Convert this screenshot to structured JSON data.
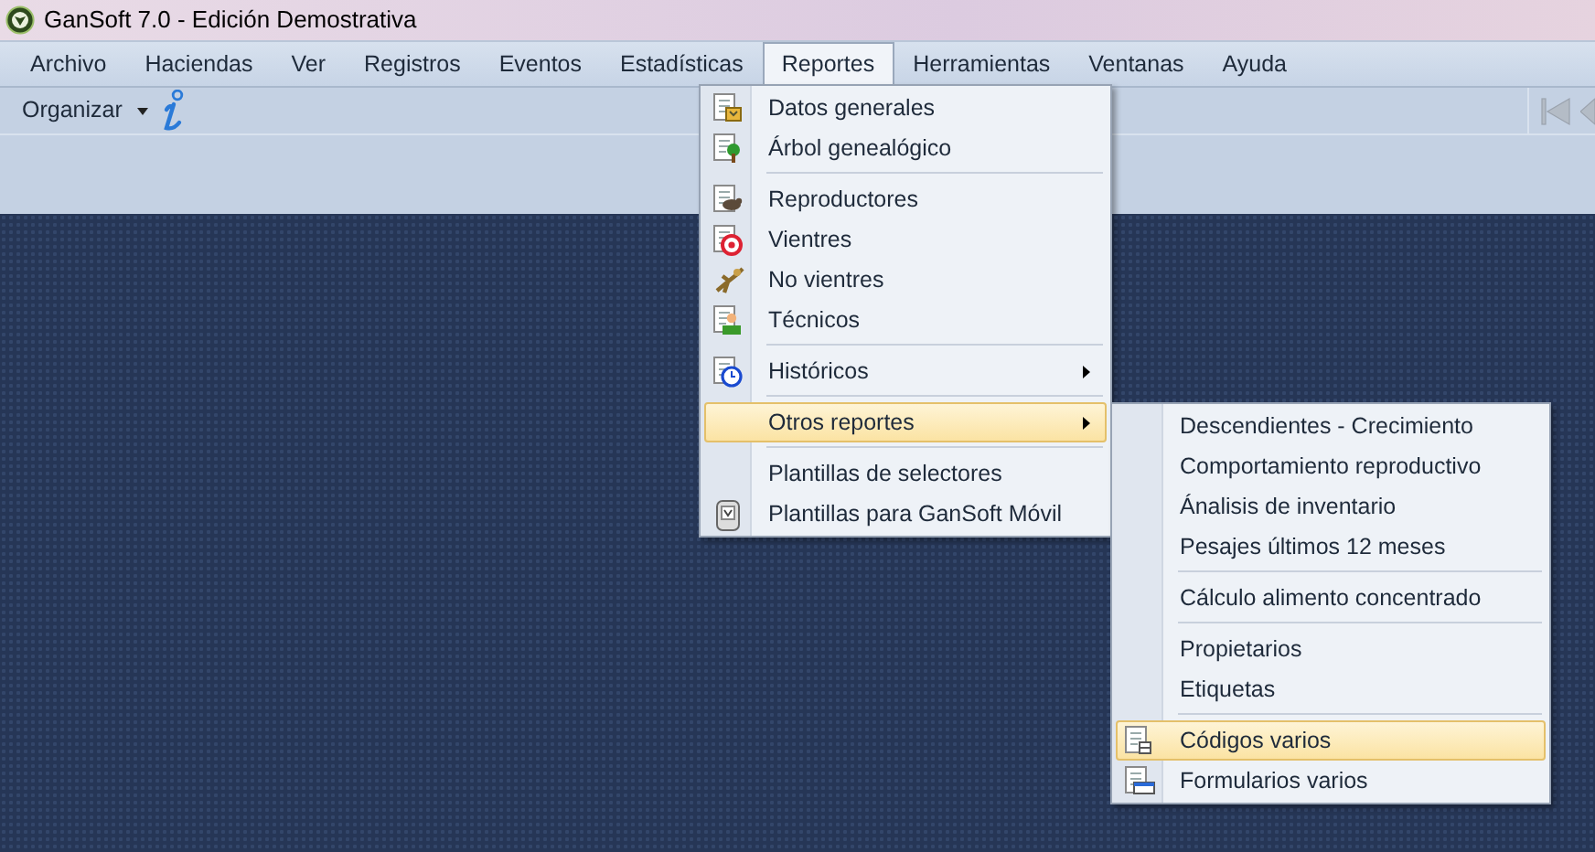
{
  "window": {
    "title": "GanSoft 7.0 - Edición Demostrativa"
  },
  "menubar": [
    {
      "label": "Archivo",
      "selected": false
    },
    {
      "label": "Haciendas",
      "selected": false
    },
    {
      "label": "Ver",
      "selected": false
    },
    {
      "label": "Registros",
      "selected": false
    },
    {
      "label": "Eventos",
      "selected": false
    },
    {
      "label": "Estadísticas",
      "selected": false
    },
    {
      "label": "Reportes",
      "selected": true
    },
    {
      "label": "Herramientas",
      "selected": false
    },
    {
      "label": "Ventanas",
      "selected": false
    },
    {
      "label": "Ayuda",
      "selected": false
    }
  ],
  "toolbar": {
    "organize_button": {
      "label": "Organizar"
    }
  },
  "menu": [
    {
      "kind": "item",
      "label": "Datos generales",
      "has_icon": true,
      "submenu": false,
      "highlighted": false
    },
    {
      "kind": "item",
      "label": "Árbol genealógico",
      "has_icon": true,
      "submenu": false,
      "highlighted": false
    },
    {
      "kind": "separator"
    },
    {
      "kind": "item",
      "label": "Reproductores",
      "has_icon": true,
      "submenu": false,
      "highlighted": false
    },
    {
      "kind": "item",
      "label": "Vientres",
      "has_icon": true,
      "submenu": false,
      "highlighted": false
    },
    {
      "kind": "item",
      "label": "No vientres",
      "has_icon": true,
      "submenu": false,
      "highlighted": false
    },
    {
      "kind": "item",
      "label": "Técnicos",
      "has_icon": true,
      "submenu": false,
      "highlighted": false
    },
    {
      "kind": "separator"
    },
    {
      "kind": "item",
      "label": "Históricos",
      "has_icon": true,
      "submenu": true,
      "highlighted": false
    },
    {
      "kind": "separator"
    },
    {
      "kind": "item",
      "label": "Otros reportes",
      "has_icon": false,
      "submenu": true,
      "highlighted": true
    },
    {
      "kind": "separator"
    },
    {
      "kind": "item",
      "label": "Plantillas de selectores",
      "has_icon": false,
      "submenu": false,
      "highlighted": false
    },
    {
      "kind": "item",
      "label": "Plantillas para GanSoft Móvil",
      "has_icon": true,
      "submenu": false,
      "highlighted": false
    }
  ],
  "submenu": [
    {
      "kind": "item",
      "label": "Descendientes - Crecimiento",
      "has_icon": false,
      "highlighted": false
    },
    {
      "kind": "item",
      "label": "Comportamiento reproductivo",
      "has_icon": false,
      "highlighted": false
    },
    {
      "kind": "item",
      "label": "Ánalisis de inventario",
      "has_icon": false,
      "highlighted": false
    },
    {
      "kind": "item",
      "label": "Pesajes últimos 12 meses",
      "has_icon": false,
      "highlighted": false
    },
    {
      "kind": "separator"
    },
    {
      "kind": "item",
      "label": "Cálculo alimento concentrado",
      "has_icon": false,
      "highlighted": false
    },
    {
      "kind": "separator"
    },
    {
      "kind": "item",
      "label": "Propietarios",
      "has_icon": false,
      "highlighted": false
    },
    {
      "kind": "item",
      "label": "Etiquetas",
      "has_icon": false,
      "highlighted": false
    },
    {
      "kind": "separator"
    },
    {
      "kind": "item",
      "label": "Códigos varios",
      "has_icon": true,
      "highlighted": true
    },
    {
      "kind": "item",
      "label": "Formularios varios",
      "has_icon": true,
      "highlighted": false
    }
  ]
}
